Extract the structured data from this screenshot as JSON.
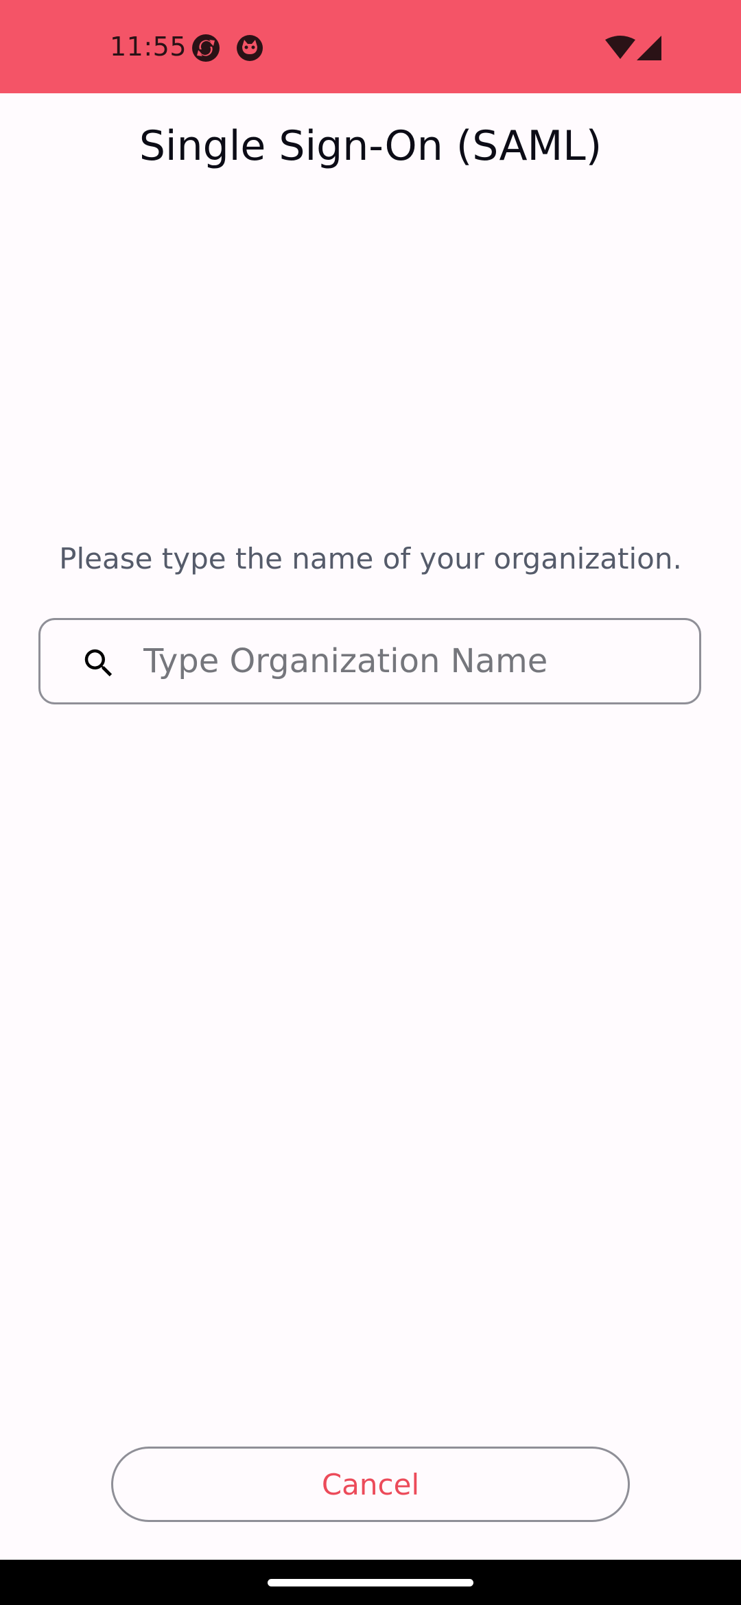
{
  "status_bar": {
    "time": "11:55",
    "icons": [
      "sync-app-icon",
      "cat-face-app-icon",
      "wifi-icon",
      "cellular-signal-icon"
    ],
    "background_color": "#f45467"
  },
  "header": {
    "title": "Single Sign-On (SAML)"
  },
  "main": {
    "prompt": "Please type the name of your organization.",
    "search": {
      "value": "",
      "placeholder": "Type Organization Name",
      "icon": "search-icon"
    }
  },
  "footer": {
    "cancel_label": "Cancel",
    "accent_color": "#ec4b5a"
  }
}
